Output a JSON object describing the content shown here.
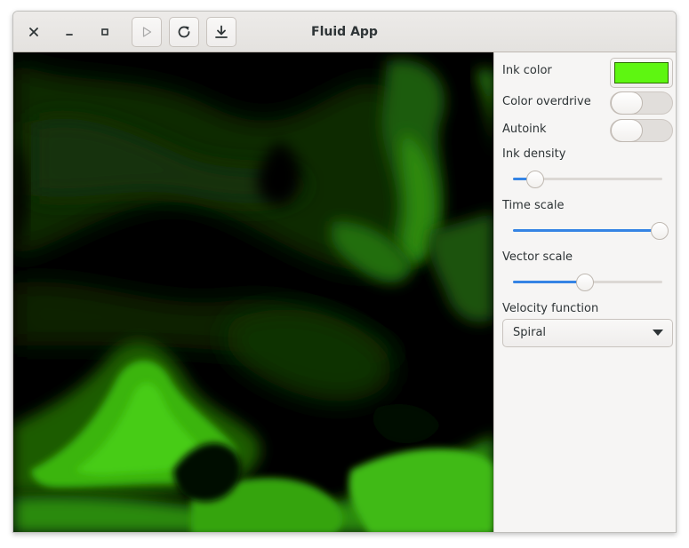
{
  "window": {
    "title": "Fluid App"
  },
  "icons": {
    "close": "close-icon",
    "minimize": "minimize-icon",
    "maximize": "maximize-icon",
    "play": "play-icon",
    "reset": "reload-icon",
    "save": "download-icon"
  },
  "sidebar": {
    "ink_color": {
      "label": "Ink color",
      "value": "#5ef611"
    },
    "color_overdrive": {
      "label": "Color overdrive",
      "enabled": false
    },
    "autoink": {
      "label": "Autoink",
      "enabled": false
    },
    "ink_density": {
      "label": "Ink density",
      "fraction": 0.15
    },
    "time_scale": {
      "label": "Time scale",
      "fraction": 0.98
    },
    "vector_scale": {
      "label": "Vector scale",
      "fraction": 0.48
    },
    "velocity_function": {
      "label": "Velocity function",
      "selected": "Spiral"
    }
  },
  "colors": {
    "accent": "#3584e4",
    "ink": "#5ef611",
    "canvas_background": "#000000"
  }
}
